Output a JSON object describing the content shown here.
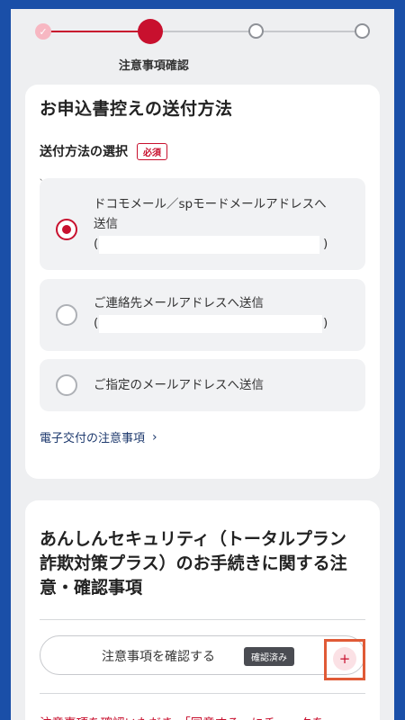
{
  "stepper": {
    "current_label": "注意事項確認",
    "check_glyph": "✓"
  },
  "delivery": {
    "title": "お申込書控えの送付方法",
    "select_label": "送付方法の選択",
    "required_badge": "必須",
    "tick_mark": "、",
    "options": [
      {
        "line1": "ドコモメール／spモードメールアドレスへ",
        "line2": "送信",
        "paren_open": "(",
        "paren_close": ")",
        "selected": true
      },
      {
        "line1": "ご連絡先メールアドレスへ送信",
        "paren_open": "(",
        "paren_close": ")",
        "selected": false
      },
      {
        "line1": "ご指定のメールアドレスへ送信",
        "selected": false
      }
    ],
    "link_text": "電子交付の注意事項",
    "link_chevron": "›"
  },
  "security": {
    "title": "あんしんセキュリティ（トータルプラン 詐欺対策プラス）のお手続きに関する注意・確認事項",
    "confirm_label": "注意事項を確認する",
    "confirmed_badge": "確認済み",
    "plus_glyph": "+",
    "footer_text": "注意事項を確認いただき、「同意する」にチェックを"
  },
  "colors": {
    "brand_red": "#c8102e",
    "frame_blue": "#1a4fa8",
    "highlight_orange": "#e05a36"
  }
}
